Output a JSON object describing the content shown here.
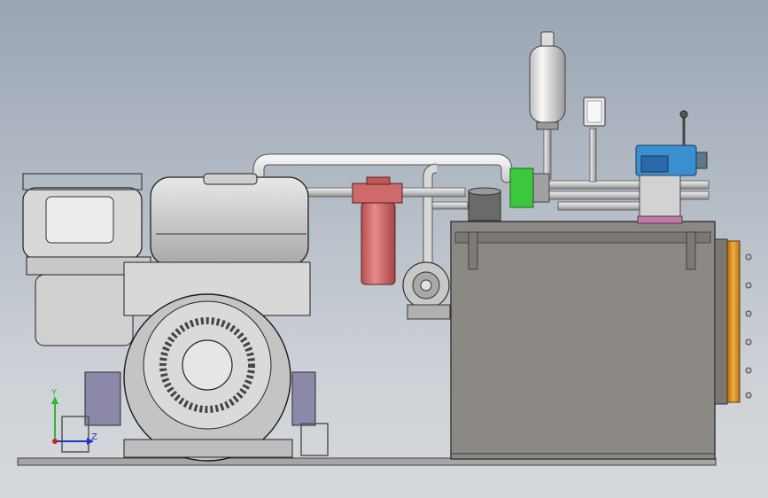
{
  "viewport": {
    "background_top": "#9aa5b3",
    "background_bottom": "#d6d9dc"
  },
  "triad": {
    "y_label": "Y",
    "z_label": "Z",
    "y_color": "#2fb52f",
    "z_color": "#2233cc",
    "x_color": "#cc2222"
  },
  "model": {
    "tank_color": "#8c8985",
    "filter_color": "#d46a6a",
    "valve_color": "#3a8fd0",
    "flange_color": "#e39a2a",
    "coupling_color": "#3cc83c",
    "engine_color": "#c9c9c9",
    "mount_color": "#8c88a8"
  }
}
